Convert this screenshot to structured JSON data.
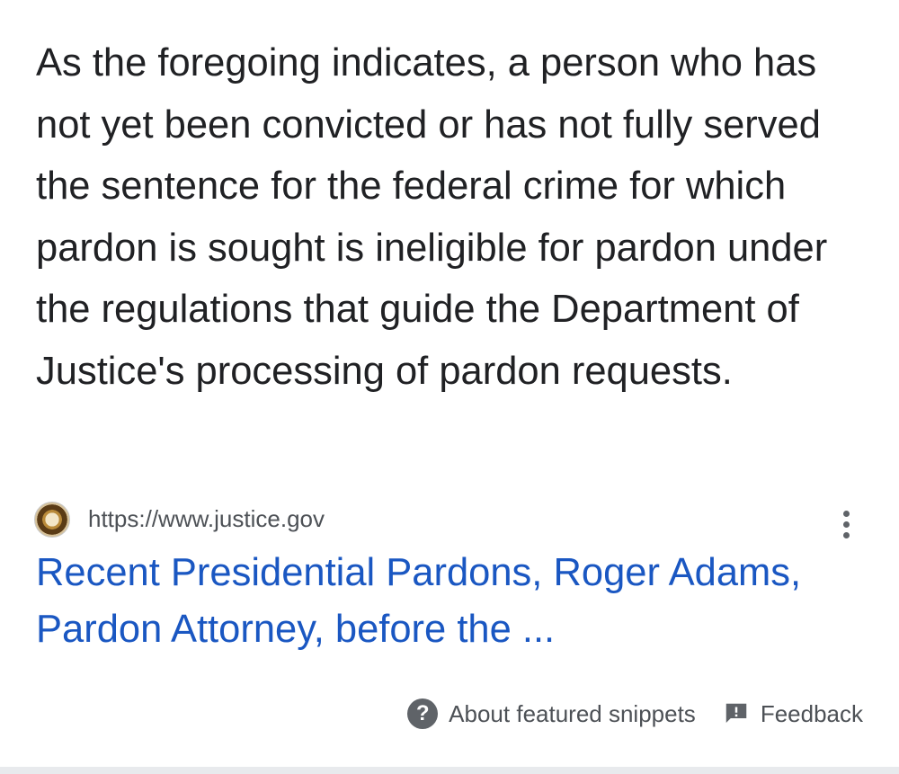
{
  "snippet": {
    "text": "As the foregoing indicates, a person who has not yet been convicted or has not fully served the sentence for the federal crime for which pardon is sought is ineligible for pardon under the regulations that guide the Department of Justice's processing of pardon requests."
  },
  "source": {
    "favicon": "doj-seal-icon",
    "url": "https://www.justice.gov",
    "more_icon": "more-vert-icon"
  },
  "result": {
    "title": "Recent Presidential Pardons, Roger Adams, Pardon Attorney, before the ..."
  },
  "footer": {
    "about_label": "About featured snippets",
    "about_icon": "help-icon",
    "feedback_label": "Feedback",
    "feedback_icon": "feedback-icon"
  },
  "colors": {
    "text": "#202124",
    "link": "#1a57c2",
    "secondary": "#4d5156",
    "icon": "#5f6368"
  }
}
